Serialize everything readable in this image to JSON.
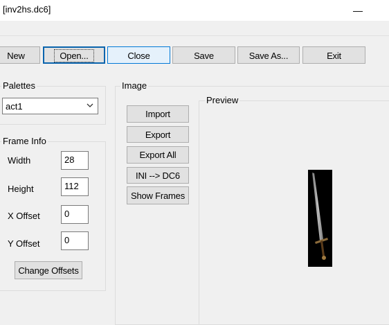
{
  "window": {
    "title": "[inv2hs.dc6]",
    "minimize_glyph": "—"
  },
  "toolbar": {
    "new_label": "New",
    "open_label": "Open...",
    "close_label": "Close",
    "save_label": "Save",
    "save_as_label": "Save As...",
    "exit_label": "Exit"
  },
  "palettes": {
    "group_label": "Palettes",
    "selected": "act1"
  },
  "frame_info": {
    "group_label": "Frame Info",
    "width_label": "Width",
    "width_value": "28",
    "height_label": "Height",
    "height_value": "112",
    "x_offset_label": "X Offset",
    "x_offset_value": "0",
    "y_offset_label": "Y Offset",
    "y_offset_value": "0",
    "change_offsets_label": "Change Offsets"
  },
  "image": {
    "group_label": "Image",
    "import_label": "Import",
    "export_label": "Export",
    "export_all_label": "Export All",
    "ini_dc6_label": "INI --> DC6",
    "show_frames_label": "Show Frames"
  },
  "preview": {
    "group_label": "Preview",
    "image_icon": "sword-icon"
  },
  "colors": {
    "accent": "#0078d7",
    "button_bg": "#e1e1e1",
    "window_bg": "#f0f0f0"
  }
}
